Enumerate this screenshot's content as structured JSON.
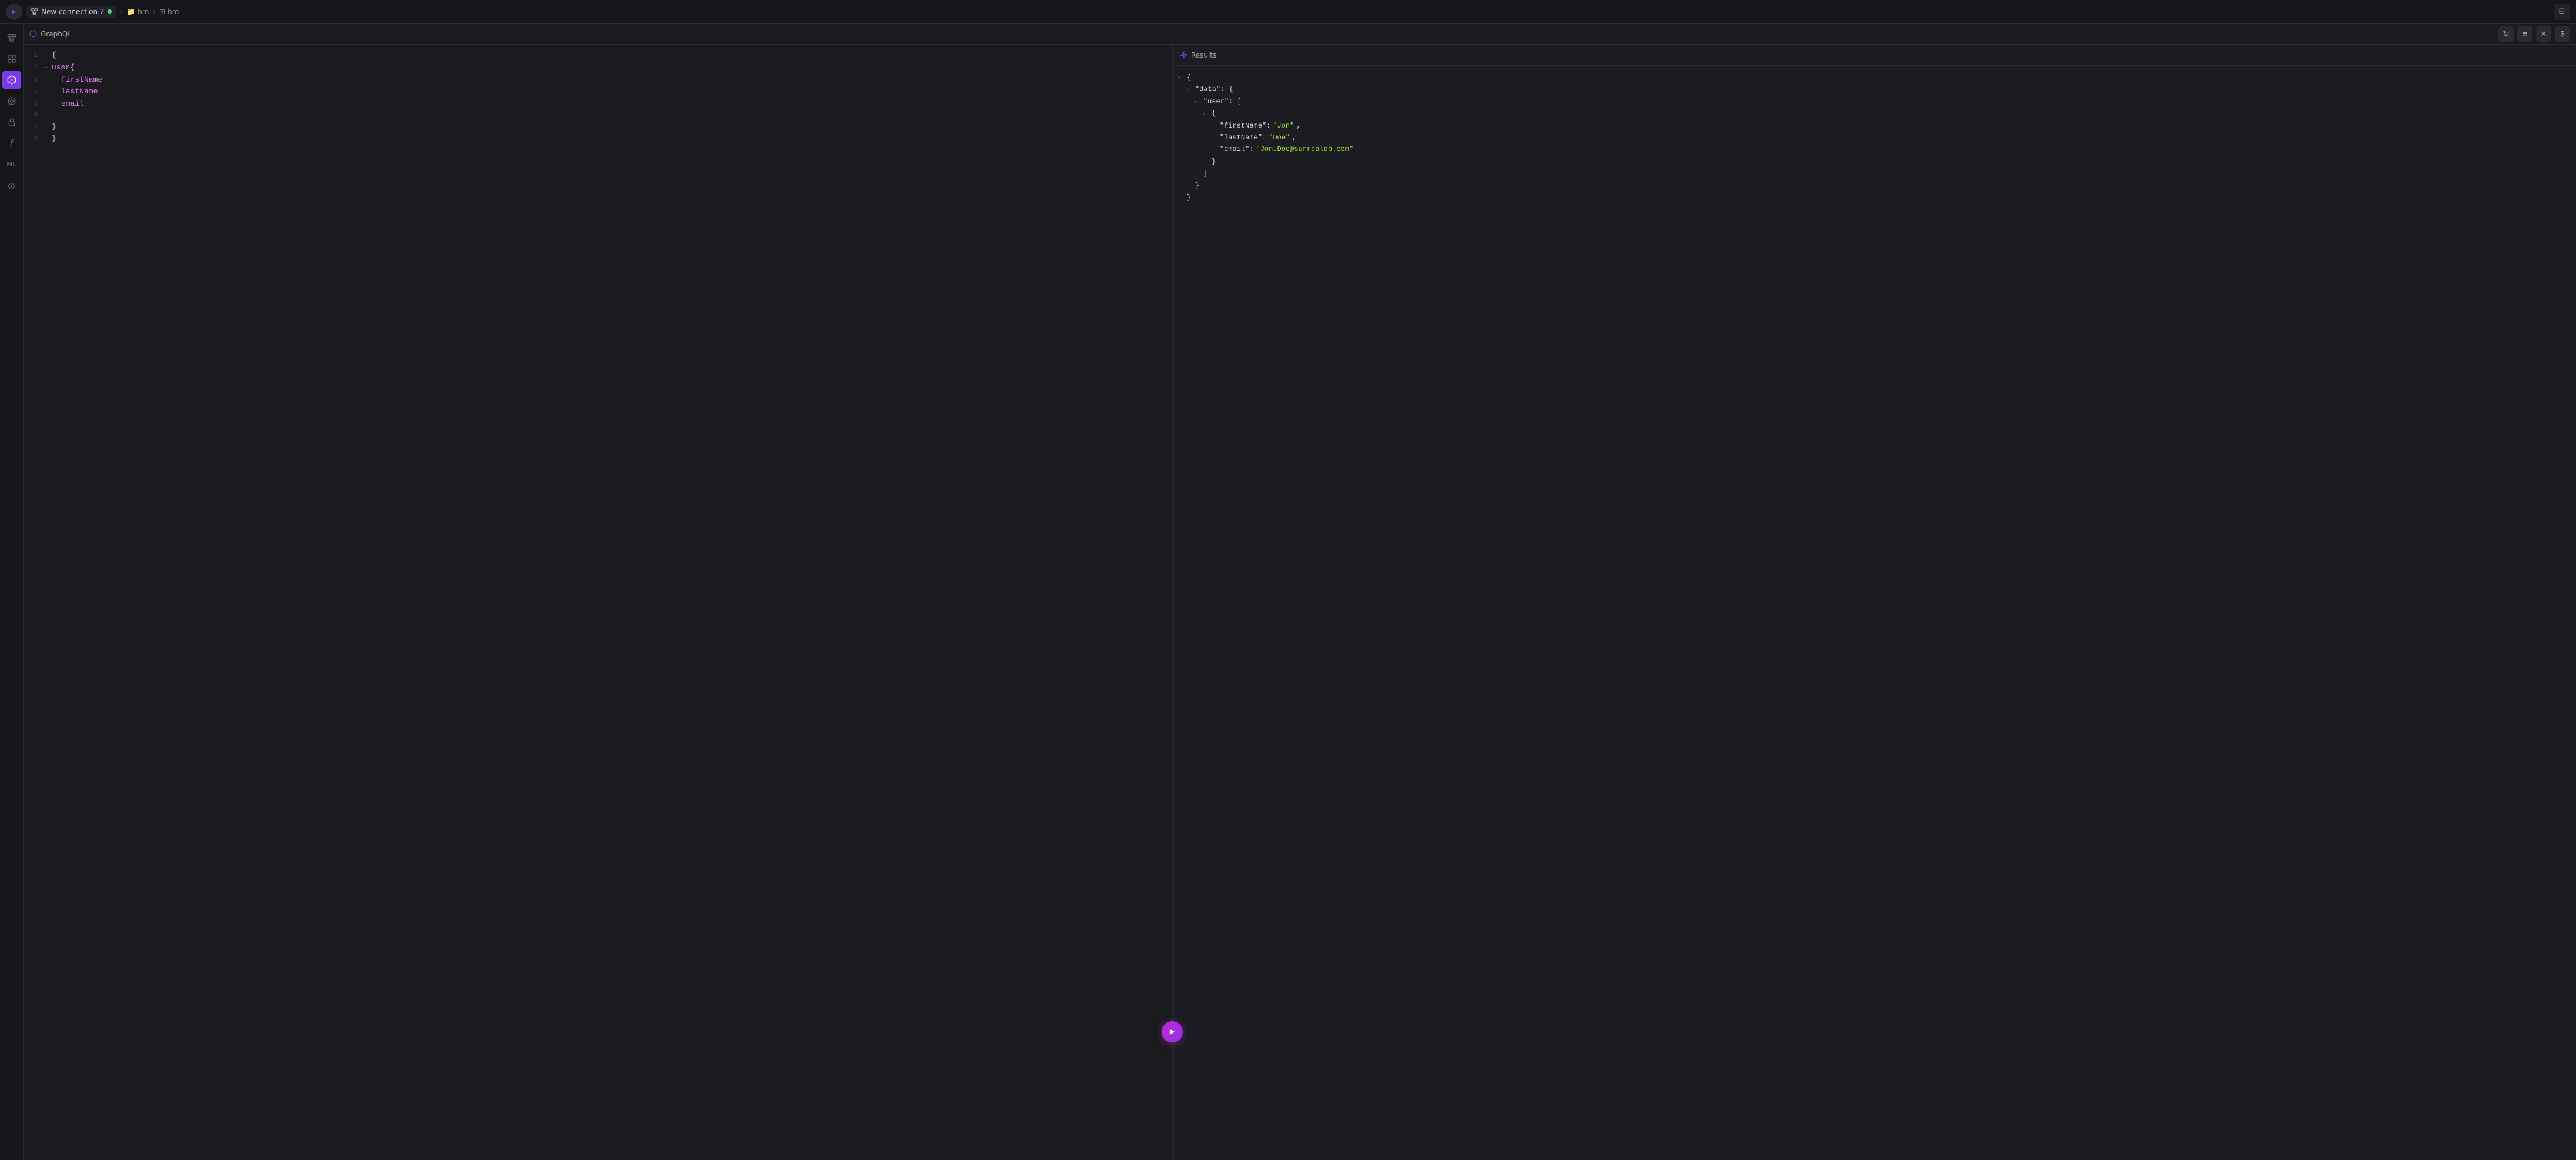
{
  "topbar": {
    "connection_name": "New connection 2",
    "connection_dot_color": "#4ade80",
    "breadcrumb1": "hm",
    "breadcrumb2": "hm"
  },
  "toolbar": {
    "label": "GraphQL",
    "refresh_label": "↻",
    "list_label": "≡",
    "settings_label": "✕",
    "dollar_label": "$"
  },
  "results": {
    "title": "Results"
  },
  "editor": {
    "lines": [
      {
        "num": 1,
        "fold": false,
        "content": "{",
        "type": "brace"
      },
      {
        "num": 2,
        "fold": true,
        "content": "user{",
        "type": "nested"
      },
      {
        "num": 3,
        "fold": false,
        "content": "firstName",
        "type": "field",
        "indent": 1
      },
      {
        "num": 4,
        "fold": false,
        "content": "lastName",
        "type": "field",
        "indent": 1
      },
      {
        "num": 5,
        "fold": false,
        "content": "email",
        "type": "field",
        "indent": 1
      },
      {
        "num": 6,
        "fold": false,
        "content": "",
        "type": "empty"
      },
      {
        "num": 7,
        "fold": false,
        "content": "}",
        "type": "brace"
      },
      {
        "num": 8,
        "fold": false,
        "content": "}",
        "type": "brace"
      }
    ]
  },
  "json_result": {
    "raw": "{\n  \"data\": {\n    \"user\": [\n      {\n        \"firstName\": \"Jon\",\n        \"lastName\": \"Doe\",\n        \"email\": \"Jon.Doe@surrealdb.com\"\n      }\n    ]\n  }\n}"
  },
  "sidebar": {
    "items": [
      {
        "id": "connections",
        "icon": "⊡",
        "active": false
      },
      {
        "id": "explorer",
        "icon": "⊞",
        "active": false
      },
      {
        "id": "graphql",
        "icon": "✦",
        "active": true
      },
      {
        "id": "designer",
        "icon": "◈",
        "active": false
      },
      {
        "id": "security",
        "icon": "🔒",
        "active": false
      },
      {
        "id": "functions",
        "icon": "ƒ",
        "active": false
      },
      {
        "id": "ml",
        "icon": "ML",
        "active": false
      },
      {
        "id": "api",
        "icon": "</>",
        "active": false
      }
    ]
  },
  "colors": {
    "accent": "#9333ea",
    "active_sidebar": "#7c3aed",
    "string_green": "#a3e635",
    "field_pink": "#e879f9",
    "brace_white": "#c9c9d0"
  }
}
